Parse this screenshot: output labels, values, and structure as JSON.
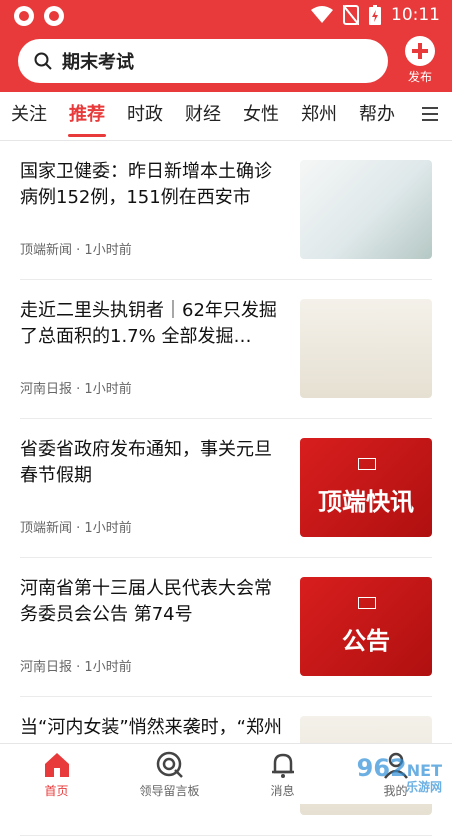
{
  "status_bar": {
    "time": "10:11"
  },
  "search": {
    "query": "期末考试"
  },
  "publish": {
    "label": "发布"
  },
  "tabs": [
    {
      "label": "关注",
      "active": false
    },
    {
      "label": "推荐",
      "active": true
    },
    {
      "label": "时政",
      "active": false
    },
    {
      "label": "财经",
      "active": false
    },
    {
      "label": "女性",
      "active": false
    },
    {
      "label": "郑州",
      "active": false
    },
    {
      "label": "帮办",
      "active": false
    }
  ],
  "feed": [
    {
      "title": "国家卫健委：昨日新增本土确诊病例152例，151例在西安市",
      "source": "顶端新闻",
      "time": "1小时前",
      "thumb": "photo",
      "thumb_text": ""
    },
    {
      "title": "走近二里头执钥者｜62年只发掘了总面积的1.7% 全部发掘…",
      "source": "河南日报",
      "time": "1小时前",
      "thumb": "portrait",
      "thumb_text": ""
    },
    {
      "title": "省委省政府发布通知，事关元旦春节假期",
      "source": "顶端新闻",
      "time": "1小时前",
      "thumb": "red",
      "thumb_text": "顶端快讯"
    },
    {
      "title": "河南省第十三届人民代表大会常务委员会公告 第74号",
      "source": "河南日报",
      "time": "1小时前",
      "thumb": "red",
      "thumb_text": "公告"
    },
    {
      "title": "当“河内女装”悄然来袭时，“郑州女装”准备好了吗？",
      "source": "",
      "time": "",
      "thumb": "portrait",
      "thumb_text": ""
    }
  ],
  "bottom_nav": [
    {
      "label": "首页",
      "icon": "home-icon",
      "active": true
    },
    {
      "label": "领导留言板",
      "icon": "message-board-icon",
      "active": false
    },
    {
      "label": "消息",
      "icon": "bell-icon",
      "active": false
    },
    {
      "label": "我的",
      "icon": "user-icon",
      "active": false
    }
  ],
  "watermark": {
    "text": "962",
    "suffix": "NET",
    "sub": "乐游网"
  },
  "colors": {
    "brand": "#e83a3a"
  }
}
